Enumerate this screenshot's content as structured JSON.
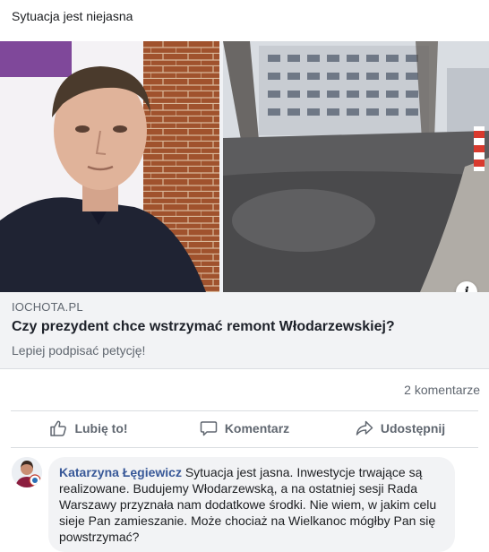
{
  "post": {
    "text": "Sytuacja jest niejasna"
  },
  "link": {
    "domain": "IOCHOTA.PL",
    "title": "Czy prezydent chce wstrzymać remont Włodarzewskiej?",
    "description": "Lepiej podpisać petycję!"
  },
  "stats": {
    "comments": "2 komentarze"
  },
  "actions": {
    "like": "Lubię to!",
    "comment": "Komentarz",
    "share": "Udostępnij"
  },
  "comment": {
    "author": "Katarzyna Łęgiewicz",
    "text": " Sytuacja jest jasna. Inwestycje trwające są realizowane. Budujemy Włodarzewską, a na ostatniej sesji Rada Warszawy przyznała nam dodatkowe środki. Nie wiem, w jakim celu sieje Pan zamieszanie. Może chociaż na Wielkanoc mógłby Pan się powstrzymać?"
  },
  "colors": {
    "link_author": "#385898",
    "secondary_text": "#606770",
    "link_box_bg": "#f2f3f5"
  },
  "icons": [
    "thumbs-up-icon",
    "comment-icon",
    "share-icon",
    "info-icon"
  ]
}
